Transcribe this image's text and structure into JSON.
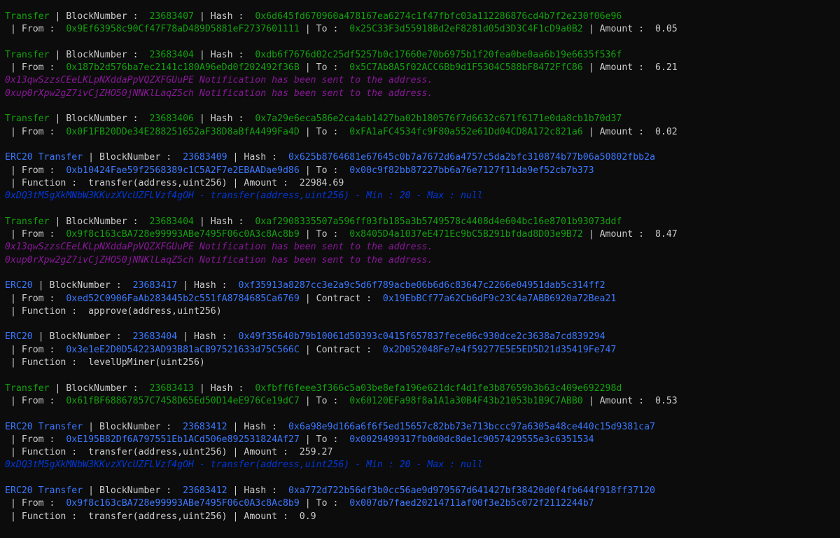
{
  "colors": {
    "background": "#0c0c0c",
    "text": "#cccccc",
    "transfer_green": "#13a10e",
    "erc20_blue": "#3b78ff",
    "notification_purple": "#881798",
    "method_blue": "#0037da"
  },
  "lines": [
    {
      "kind": "line",
      "segments": [
        {
          "t": "Transfer",
          "c": "g"
        },
        {
          "t": " | BlockNumber :  ",
          "c": "w"
        },
        {
          "t": "23683407",
          "c": "g"
        },
        {
          "t": " | Hash :  ",
          "c": "w"
        },
        {
          "t": "0x6d645fd670960a478167ea6274c1f47fbfc03a112286876cd4b7f2e230f06e96",
          "c": "g"
        }
      ]
    },
    {
      "kind": "line",
      "segments": [
        {
          "t": " | From :  ",
          "c": "w"
        },
        {
          "t": "0x9Ef63958c90Cf47F78aD489D5881eF2737601111",
          "c": "g"
        },
        {
          "t": " | To :  ",
          "c": "w"
        },
        {
          "t": "0x25C33F3d55918Bd2eF8281d05d3D3C4F1cD9a0B2",
          "c": "g"
        },
        {
          "t": " | Amount :  0.05",
          "c": "w"
        }
      ]
    },
    {
      "kind": "blank"
    },
    {
      "kind": "line",
      "segments": [
        {
          "t": "Transfer",
          "c": "g"
        },
        {
          "t": " | BlockNumber :  ",
          "c": "w"
        },
        {
          "t": "23683404",
          "c": "g"
        },
        {
          "t": " | Hash :  ",
          "c": "w"
        },
        {
          "t": "0xdb6f7676d02c25df5257b0c17660e70b6975b1f20fea0be0aa6b19e6635f536f",
          "c": "g"
        }
      ]
    },
    {
      "kind": "line",
      "segments": [
        {
          "t": " | From :  ",
          "c": "w"
        },
        {
          "t": "0x187b2d576ba7ec2141c180A96eDd0f202492f36B",
          "c": "g"
        },
        {
          "t": " | To :  ",
          "c": "w"
        },
        {
          "t": "0x5C7Ab8A5f02ACC6Bb9d1F5304C588bF8472FfC86",
          "c": "g"
        },
        {
          "t": " | Amount :  6.21",
          "c": "w"
        }
      ]
    },
    {
      "kind": "line",
      "segments": [
        {
          "t": "0x13qwSzzsCEeLKLpNXddaPpVQZXFGUuPE Notification has been sent to the address.",
          "c": "p"
        }
      ]
    },
    {
      "kind": "line",
      "segments": [
        {
          "t": "0xup0rXpw2gZ7ivCjZHO50jNNKlLaqZ5ch Notification has been sent to the address.",
          "c": "p"
        }
      ]
    },
    {
      "kind": "blank"
    },
    {
      "kind": "line",
      "segments": [
        {
          "t": "Transfer",
          "c": "g"
        },
        {
          "t": " | BlockNumber :  ",
          "c": "w"
        },
        {
          "t": "23683406",
          "c": "g"
        },
        {
          "t": " | Hash :  ",
          "c": "w"
        },
        {
          "t": "0x7a29e6eca586e2ca4ab1427ba02b180576f7d6632c671f6171e0da8cb1b70d37",
          "c": "g"
        }
      ]
    },
    {
      "kind": "line",
      "segments": [
        {
          "t": " | From :  ",
          "c": "w"
        },
        {
          "t": "0x0F1FB20DDe34E288251652aF38D8aBfA4499Fa4D",
          "c": "g"
        },
        {
          "t": " | To :  ",
          "c": "w"
        },
        {
          "t": "0xFA1aFC4534fc9F80a552e61Dd04CD8A172c821a6",
          "c": "g"
        },
        {
          "t": " | Amount :  0.02",
          "c": "w"
        }
      ]
    },
    {
      "kind": "blank"
    },
    {
      "kind": "line",
      "segments": [
        {
          "t": "ERC20 Transfer",
          "c": "b"
        },
        {
          "t": " | BlockNumber :  ",
          "c": "w"
        },
        {
          "t": "23683409",
          "c": "b"
        },
        {
          "t": " | Hash :  ",
          "c": "w"
        },
        {
          "t": "0x625b8764681e67645c0b7a7672d6a4757c5da2bfc310874b77b06a50802fbb2a",
          "c": "b"
        }
      ]
    },
    {
      "kind": "line",
      "segments": [
        {
          "t": " | From :  ",
          "c": "w"
        },
        {
          "t": "0xb10424Fae59f2568389c1C5A2F7e2EBAADae9d86",
          "c": "b"
        },
        {
          "t": " | To :  ",
          "c": "w"
        },
        {
          "t": "0x00c9f82bb87227bb6a76e7127f11da9ef52cb7b373",
          "c": "b"
        }
      ]
    },
    {
      "kind": "line",
      "segments": [
        {
          "t": " | Function :  transfer(address,uint256) | Amount :  22984.69",
          "c": "w"
        }
      ]
    },
    {
      "kind": "line",
      "segments": [
        {
          "t": "0xDQ3tM5gXkMNbW3KKvzXVcUZFLVzf4gOH - transfer(address,uint256) - Min : 20 - Max : null",
          "c": "bi"
        }
      ]
    },
    {
      "kind": "blank"
    },
    {
      "kind": "line",
      "segments": [
        {
          "t": "Transfer",
          "c": "g"
        },
        {
          "t": " | BlockNumber :  ",
          "c": "w"
        },
        {
          "t": "23683404",
          "c": "g"
        },
        {
          "t": " | Hash :  ",
          "c": "w"
        },
        {
          "t": "0xaf2908335507a596ff03fb185a3b5749578c4408d4e604bc16e8701b93073ddf",
          "c": "g"
        }
      ]
    },
    {
      "kind": "line",
      "segments": [
        {
          "t": " | From :  ",
          "c": "w"
        },
        {
          "t": "0x9f8c163cBA728e99993ABe7495F06c0A3c8Ac8b9",
          "c": "g"
        },
        {
          "t": " | To :  ",
          "c": "w"
        },
        {
          "t": "0x8405D4a1037eE471Ec9bC5B291bfdad8D03e9B72",
          "c": "g"
        },
        {
          "t": " | Amount :  8.47",
          "c": "w"
        }
      ]
    },
    {
      "kind": "line",
      "segments": [
        {
          "t": "0x13qwSzzsCEeLKLpNXddaPpVQZXFGUuPE Notification has been sent to the address.",
          "c": "p"
        }
      ]
    },
    {
      "kind": "line",
      "segments": [
        {
          "t": "0xup0rXpw2gZ7ivCjZHO50jNNKlLaqZ5ch Notification has been sent to the address.",
          "c": "p"
        }
      ]
    },
    {
      "kind": "blank"
    },
    {
      "kind": "line",
      "segments": [
        {
          "t": "ERC20",
          "c": "b"
        },
        {
          "t": " | BlockNumber :  ",
          "c": "w"
        },
        {
          "t": "23683417",
          "c": "b"
        },
        {
          "t": " | Hash :  ",
          "c": "w"
        },
        {
          "t": "0xf35913a8287cc3e2a9c5d6f789acbe06b6d6c83647c2266e04951dab5c314ff2",
          "c": "b"
        }
      ]
    },
    {
      "kind": "line",
      "segments": [
        {
          "t": " | From :  ",
          "c": "w"
        },
        {
          "t": "0xed52C0906FaAb283445b2c551fA8784685Ca6769",
          "c": "b"
        },
        {
          "t": " | Contract :  ",
          "c": "w"
        },
        {
          "t": "0x19EbBCf77a62Cb6dF9c23C4a7ABB6920a72Bea21",
          "c": "b"
        }
      ]
    },
    {
      "kind": "line",
      "segments": [
        {
          "t": " | Function :  approve(address,uint256)",
          "c": "w"
        }
      ]
    },
    {
      "kind": "blank"
    },
    {
      "kind": "line",
      "segments": [
        {
          "t": "ERC20",
          "c": "b"
        },
        {
          "t": " | BlockNumber :  ",
          "c": "w"
        },
        {
          "t": "23683404",
          "c": "b"
        },
        {
          "t": " | Hash :  ",
          "c": "w"
        },
        {
          "t": "0x49f35640b79b10061d50393c0415f657837fece06c930dce2c3638a7cd839294",
          "c": "b"
        }
      ]
    },
    {
      "kind": "line",
      "segments": [
        {
          "t": " | From :  ",
          "c": "w"
        },
        {
          "t": "0x3e1eE2D0D54223AD93B81aCB97521633d75C566C",
          "c": "b"
        },
        {
          "t": " | Contract :  ",
          "c": "w"
        },
        {
          "t": "0x2D052048Fe7e4f59277E5E5ED5D21d35419Fe747",
          "c": "b"
        }
      ]
    },
    {
      "kind": "line",
      "segments": [
        {
          "t": " | Function :  levelUpMiner(uint256)",
          "c": "w"
        }
      ]
    },
    {
      "kind": "blank"
    },
    {
      "kind": "line",
      "segments": [
        {
          "t": "Transfer",
          "c": "g"
        },
        {
          "t": " | BlockNumber :  ",
          "c": "w"
        },
        {
          "t": "23683413",
          "c": "g"
        },
        {
          "t": " | Hash :  ",
          "c": "w"
        },
        {
          "t": "0xfbff6feee3f366c5a03be8efa196e621dcf4d1fe3b87659b3b63c409e692298d",
          "c": "g"
        }
      ]
    },
    {
      "kind": "line",
      "segments": [
        {
          "t": " | From :  ",
          "c": "w"
        },
        {
          "t": "0x61fBF68867857C7458D65Ed50D14eE976Ce19dC7",
          "c": "g"
        },
        {
          "t": " | To :  ",
          "c": "w"
        },
        {
          "t": "0x60120EFa98f8a1A1a30B4F43b21053b1B9C7ABB0",
          "c": "g"
        },
        {
          "t": " | Amount :  0.53",
          "c": "w"
        }
      ]
    },
    {
      "kind": "blank"
    },
    {
      "kind": "line",
      "segments": [
        {
          "t": "ERC20 Transfer",
          "c": "b"
        },
        {
          "t": " | BlockNumber :  ",
          "c": "w"
        },
        {
          "t": "23683412",
          "c": "b"
        },
        {
          "t": " | Hash :  ",
          "c": "w"
        },
        {
          "t": "0x6a98e9d166a6f6f5ed15657c82bb73e713bccc97a6305a48ce440c15d9381ca7",
          "c": "b"
        }
      ]
    },
    {
      "kind": "line",
      "segments": [
        {
          "t": " | From :  ",
          "c": "w"
        },
        {
          "t": "0xE195B82Df6A797551Eb1ACd506e892531824Af27",
          "c": "b"
        },
        {
          "t": " | To :  ",
          "c": "w"
        },
        {
          "t": "0x0029499317fb0d0dc8de1c9057429555e3c6351534",
          "c": "b"
        }
      ]
    },
    {
      "kind": "line",
      "segments": [
        {
          "t": " | Function :  transfer(address,uint256) | Amount :  259.27",
          "c": "w"
        }
      ]
    },
    {
      "kind": "line",
      "segments": [
        {
          "t": "0xDQ3tM5gXkMNbW3KKvzXVcUZFLVzf4gOH - transfer(address,uint256) - Min : 20 - Max : null",
          "c": "bi"
        }
      ]
    },
    {
      "kind": "blank"
    },
    {
      "kind": "line",
      "segments": [
        {
          "t": "ERC20 Transfer",
          "c": "b"
        },
        {
          "t": " | BlockNumber :  ",
          "c": "w"
        },
        {
          "t": "23683412",
          "c": "b"
        },
        {
          "t": " | Hash :  ",
          "c": "w"
        },
        {
          "t": "0xa772d722b56df3b0cc56ae9d979567d641427bf38420d0f4fb644f918ff37120",
          "c": "b"
        }
      ]
    },
    {
      "kind": "line",
      "segments": [
        {
          "t": " | From :  ",
          "c": "w"
        },
        {
          "t": "0x9f8c163cBA728e99993ABe7495F06c0A3c8Ac8b9",
          "c": "b"
        },
        {
          "t": " | To :  ",
          "c": "w"
        },
        {
          "t": "0x007db7faed20214711af00f3e2b5c072f2112244b7",
          "c": "b"
        }
      ]
    },
    {
      "kind": "line",
      "segments": [
        {
          "t": " | Function :  transfer(address,uint256) | Amount :  0.9",
          "c": "w"
        }
      ]
    }
  ]
}
